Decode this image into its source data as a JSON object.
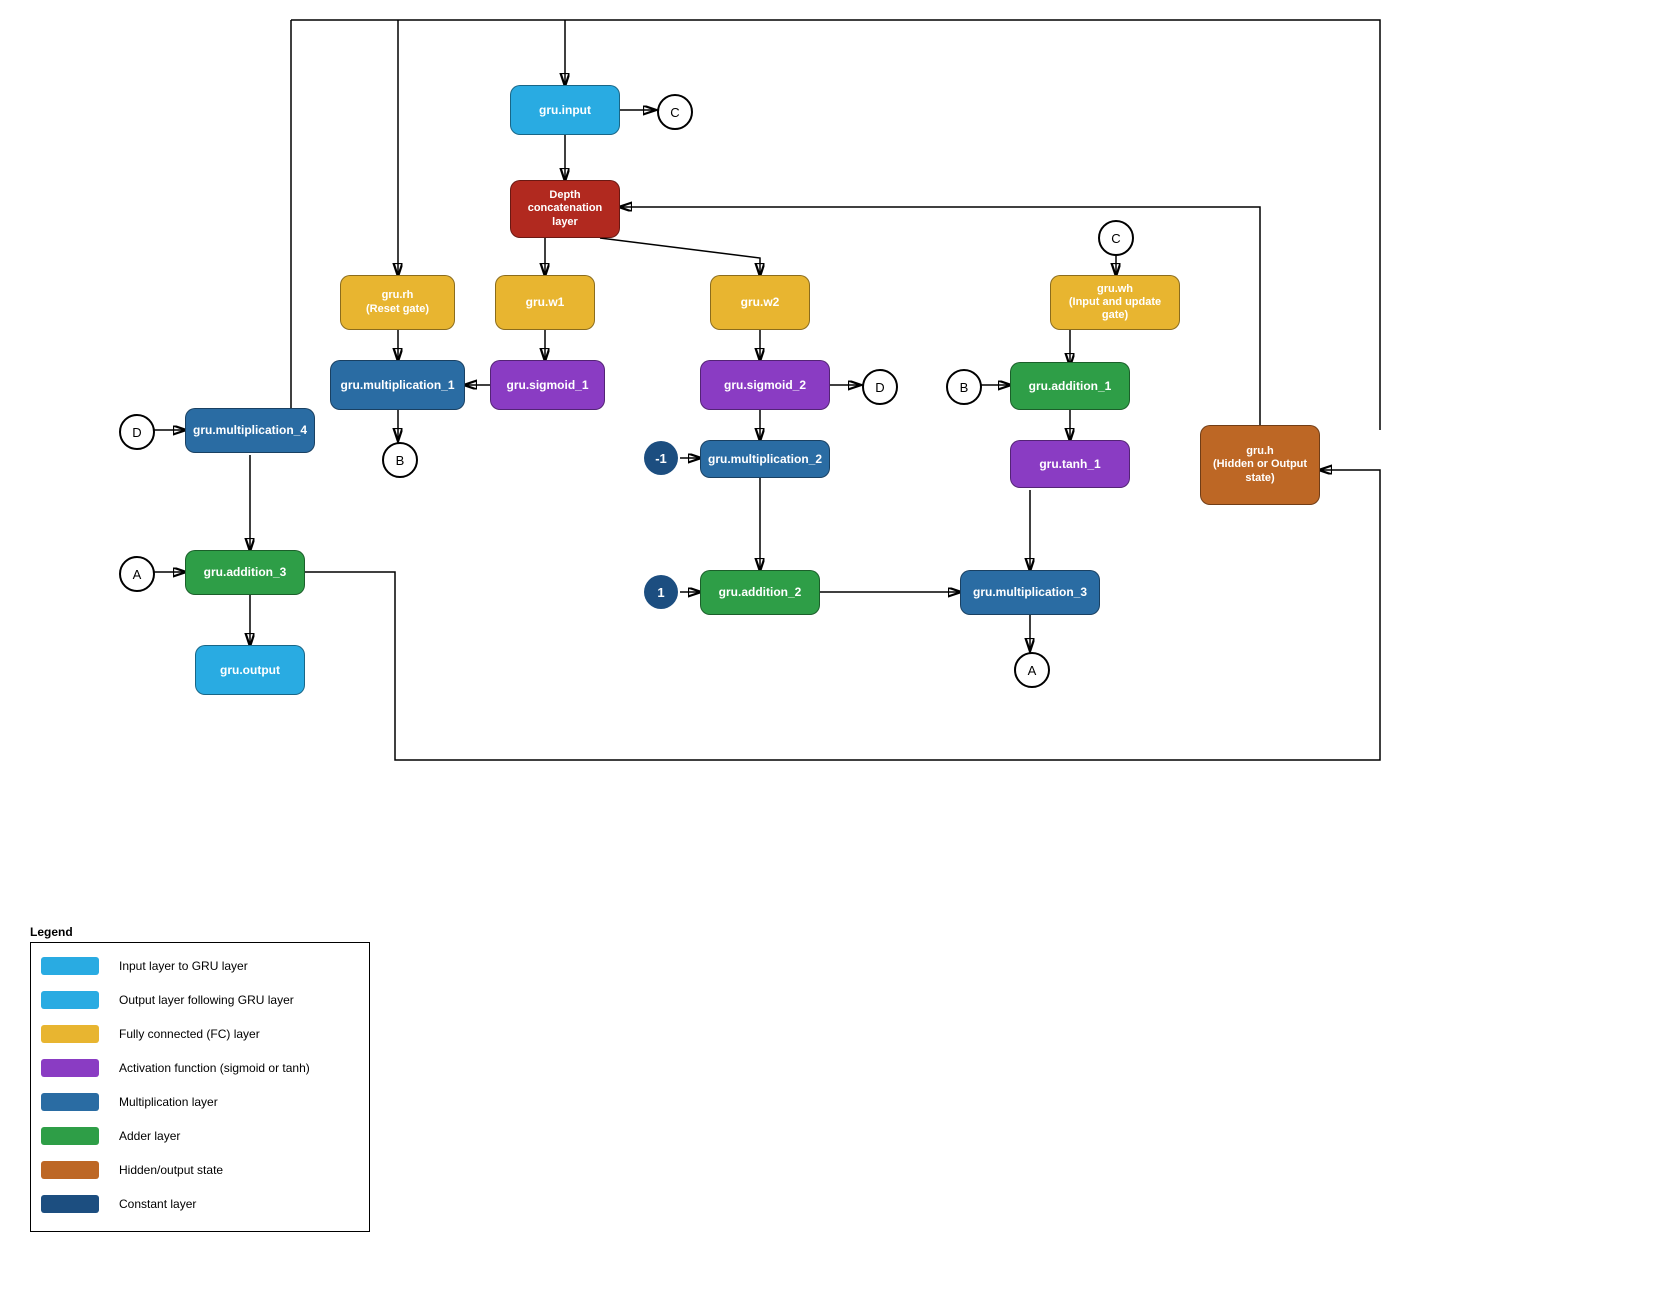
{
  "nodes": {
    "input": {
      "label": "gru.input"
    },
    "depth_concat": {
      "label": "Depth concatenation layer"
    },
    "rh": {
      "label": "gru.rh\n(Reset gate)"
    },
    "w1": {
      "label": "gru.w1"
    },
    "w2": {
      "label": "gru.w2"
    },
    "wh": {
      "label": "gru.wh\n(Input and update gate)"
    },
    "mult1": {
      "label": "gru.multiplication_1"
    },
    "sig1": {
      "label": "gru.sigmoid_1"
    },
    "sig2": {
      "label": "gru.sigmoid_2"
    },
    "add1": {
      "label": "gru.addition_1"
    },
    "mult4": {
      "label": "gru.multiplication_4"
    },
    "mult2": {
      "label": "gru.multiplication_2"
    },
    "tanh1": {
      "label": "gru.tanh_1"
    },
    "add3": {
      "label": "gru.addition_3"
    },
    "add2": {
      "label": "gru.addition_2"
    },
    "mult3": {
      "label": "gru.multiplication_3"
    },
    "h": {
      "label": "gru.h\n(Hidden or Output state)"
    },
    "output": {
      "label": "gru.output"
    }
  },
  "connectors": {
    "A_left": {
      "label": "A"
    },
    "A_bottom": {
      "label": "A"
    },
    "B_left": {
      "label": "B"
    },
    "B_mult1": {
      "label": "B"
    },
    "C_top": {
      "label": "C"
    },
    "C_wh": {
      "label": "C"
    },
    "D_left": {
      "label": "D"
    },
    "D_sig2": {
      "label": "D"
    }
  },
  "constants": {
    "neg1": {
      "label": "-1"
    },
    "pos1": {
      "label": "1"
    }
  },
  "legend": {
    "title": "Legend",
    "items": [
      {
        "color": "c-lightblue",
        "label": "Input layer to GRU layer"
      },
      {
        "color": "c-lightblue",
        "label": "Output layer following GRU layer"
      },
      {
        "color": "c-amber",
        "label": "Fully connected (FC) layer"
      },
      {
        "color": "c-purple",
        "label": "Activation function (sigmoid or tanh)"
      },
      {
        "color": "c-blue",
        "label": "Multiplication layer"
      },
      {
        "color": "c-green",
        "label": "Adder layer"
      },
      {
        "color": "c-brown",
        "label": "Hidden/output state"
      },
      {
        "color": "c-navy",
        "label": "Constant layer"
      }
    ]
  }
}
